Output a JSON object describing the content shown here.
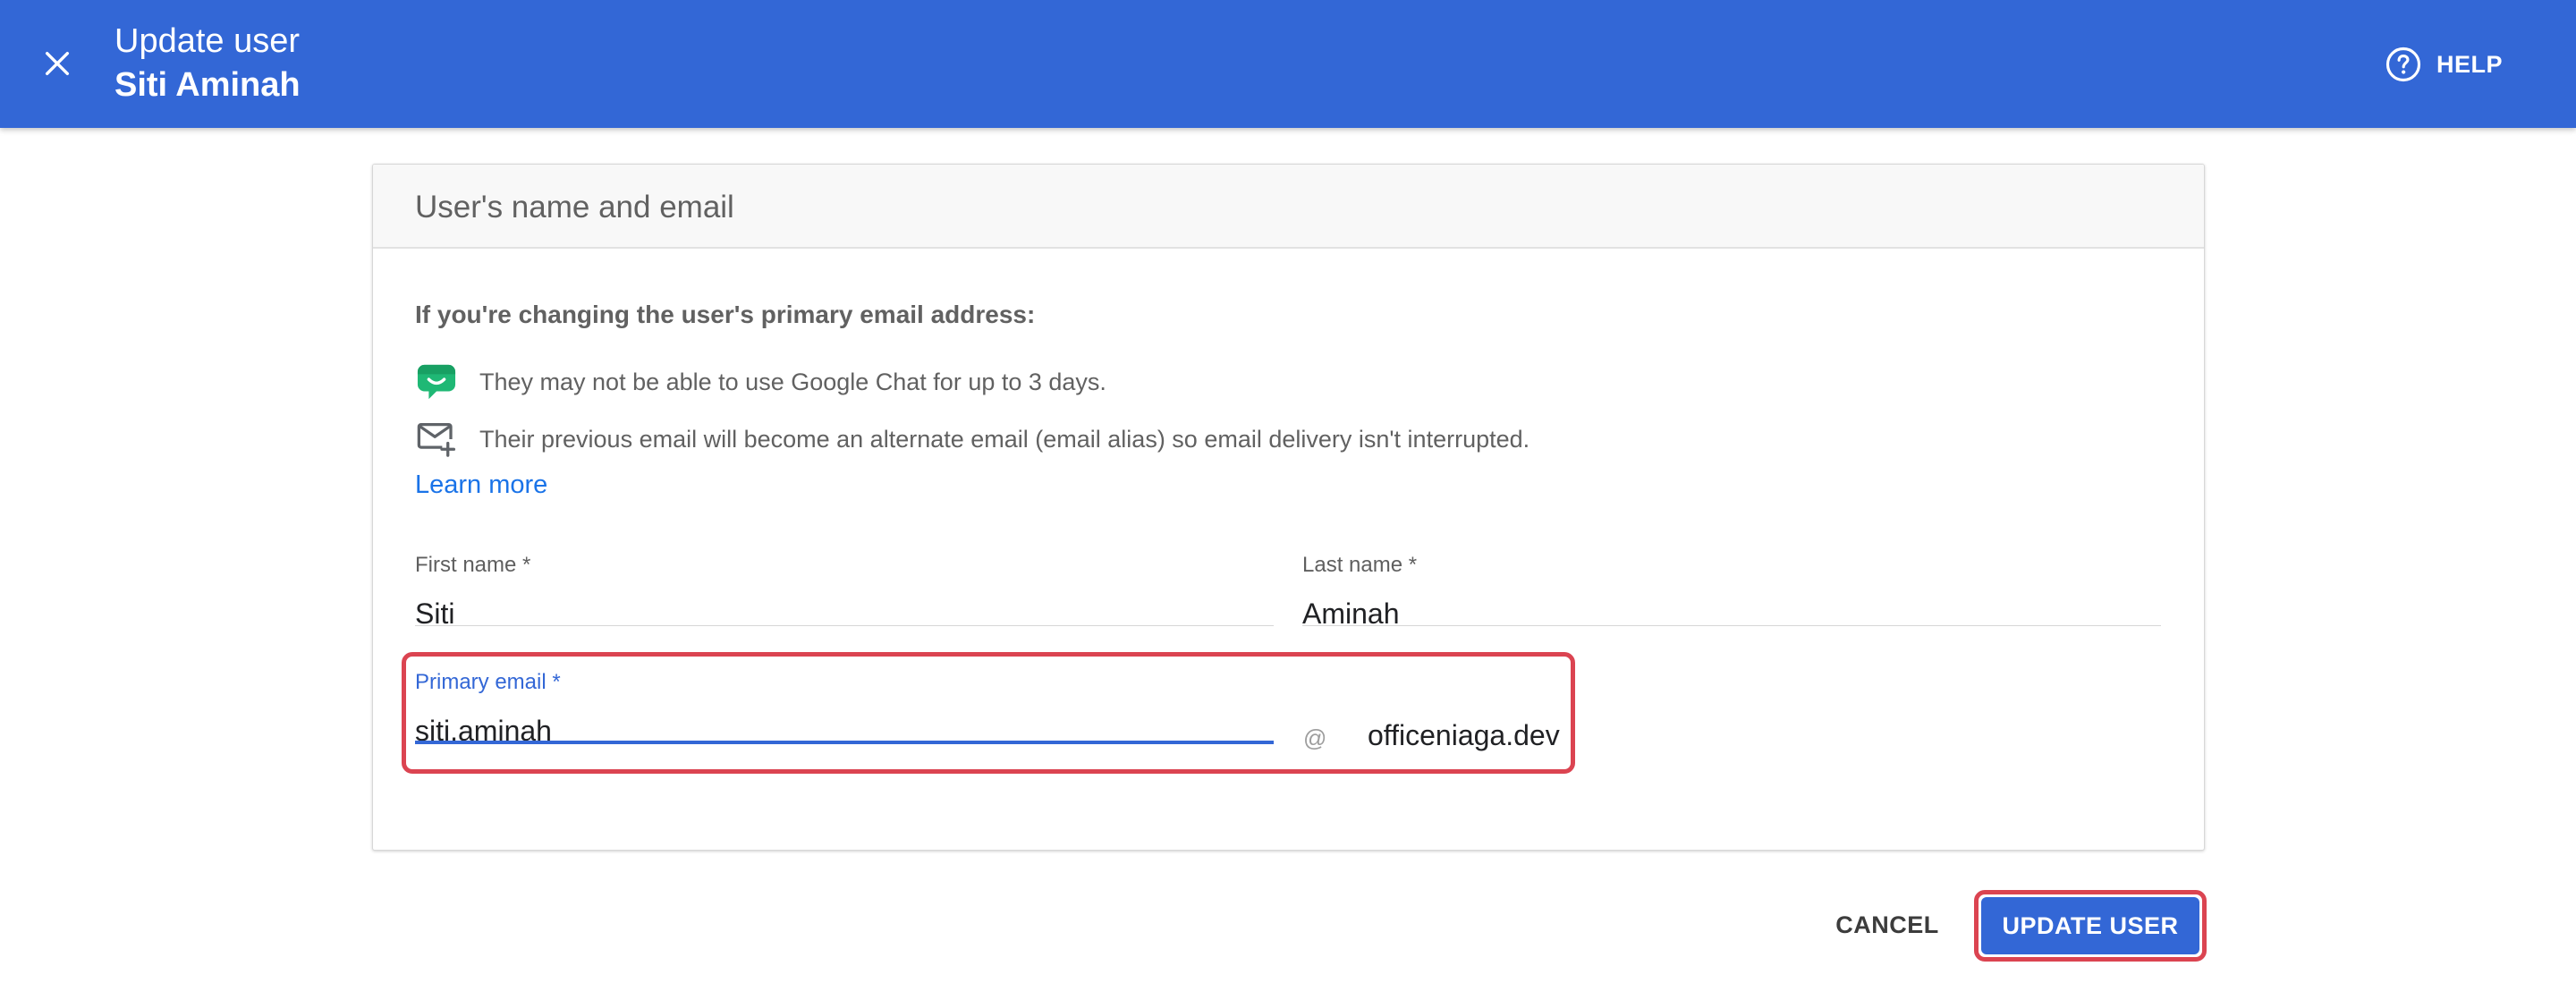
{
  "header": {
    "title": "Update user",
    "subtitle": "Siti Aminah",
    "help_label": "HELP",
    "close_icon": "close-icon",
    "help_icon": "help-circle-icon",
    "background_color": "#3367d6"
  },
  "card": {
    "title": "User's name and email",
    "notice_title": "If you're changing the user's primary email address:",
    "notices": [
      {
        "icon": "google-chat-icon",
        "text": "They may not be able to use Google Chat for up to 3 days."
      },
      {
        "icon": "email-add-icon",
        "text": "Their previous email will become an alternate email (email alias) so email delivery isn't interrupted."
      }
    ],
    "learn_more": "Learn more"
  },
  "form": {
    "first_name": {
      "label": "First name *",
      "value": "Siti"
    },
    "last_name": {
      "label": "Last name *",
      "value": "Aminah"
    },
    "primary_email": {
      "label": "Primary email *",
      "value": "siti.aminah"
    },
    "at_sign": "@",
    "domain": "officeniaga.dev"
  },
  "actions": {
    "cancel_label": "CANCEL",
    "update_label": "UPDATE USER"
  },
  "colors": {
    "accent": "#3367d6",
    "highlight": "#db4451",
    "link": "#1a73e8",
    "chat_icon": "#1fb875"
  }
}
